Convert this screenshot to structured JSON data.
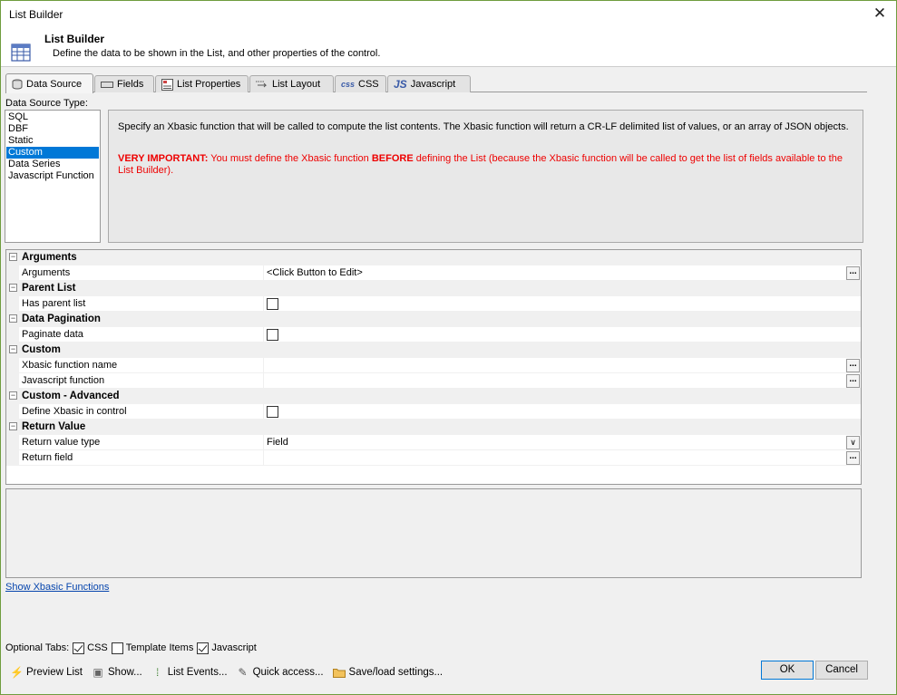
{
  "window": {
    "title": "List Builder",
    "close_glyph": "✕"
  },
  "header": {
    "icon": "table-icon",
    "title": "List Builder",
    "description": "Define the data to be shown in the List, and other properties of the control."
  },
  "tabs": [
    {
      "label": "Data Source",
      "icon": "database-icon",
      "active": true
    },
    {
      "label": "Fields",
      "icon": "field-icon"
    },
    {
      "label": "List Properties",
      "icon": "properties-icon"
    },
    {
      "label": "List Layout",
      "icon": "layout-icon"
    },
    {
      "label": "CSS",
      "icon": "css-icon",
      "icon_text": "css"
    },
    {
      "label": "Javascript",
      "icon": "js-icon",
      "icon_text": "JS"
    }
  ],
  "data_source": {
    "label": "Data Source Type:",
    "items": [
      "SQL",
      "DBF",
      "Static",
      "Custom",
      "Data Series",
      "Javascript Function"
    ],
    "selected": "Custom"
  },
  "info": {
    "text": "Specify an Xbasic function that will be called to compute the list contents. The Xbasic function will return a CR-LF delimited list of values, or an array of JSON objects.",
    "warn_prefix": "VERY IMPORTANT:",
    "warn_part1": " You must define the Xbasic function ",
    "warn_bold": "BEFORE",
    "warn_part2": " defining the List (because the Xbasic function will be called to get the list of fields available to the List Builder)."
  },
  "grid": {
    "sections": [
      {
        "title": "Arguments",
        "rows": [
          {
            "name": "Arguments",
            "value": "<Click Button to Edit>",
            "control": "button"
          }
        ]
      },
      {
        "title": "Parent List",
        "rows": [
          {
            "name": "Has parent list",
            "control": "checkbox",
            "checked": false
          }
        ]
      },
      {
        "title": "Data Pagination",
        "rows": [
          {
            "name": "Paginate data",
            "control": "checkbox",
            "checked": false
          }
        ]
      },
      {
        "title": "Custom",
        "rows": [
          {
            "name": "Xbasic function name",
            "value": "",
            "control": "button"
          },
          {
            "name": "Javascript function",
            "value": "",
            "control": "button"
          }
        ]
      },
      {
        "title": "Custom - Advanced",
        "rows": [
          {
            "name": "Define Xbasic in control",
            "control": "checkbox",
            "checked": false
          }
        ]
      },
      {
        "title": "Return Value",
        "rows": [
          {
            "name": "Return value type",
            "value": "Field",
            "control": "dropdown"
          },
          {
            "name": "Return field",
            "value": "",
            "control": "button"
          }
        ]
      }
    ],
    "expand_glyph": "−",
    "button_glyph": "...",
    "dropdown_glyph": "∨"
  },
  "link": {
    "label": "Show Xbasic Functions"
  },
  "optional_tabs": {
    "label": "Optional Tabs:",
    "items": [
      {
        "label": "CSS",
        "checked": true
      },
      {
        "label": "Template Items",
        "checked": false
      },
      {
        "label": "Javascript",
        "checked": true
      }
    ]
  },
  "toolbar": [
    {
      "label": "Preview List",
      "icon": "lightning-icon",
      "glyph": "⚡",
      "color": "#e0a800"
    },
    {
      "label": "Show...",
      "icon": "show-icon",
      "glyph": "▣",
      "color": "#666666"
    },
    {
      "label": "List Events...",
      "icon": "events-icon",
      "glyph": "⁞",
      "color": "#3a7d2c"
    },
    {
      "label": "Quick access...",
      "icon": "wand-icon",
      "glyph": "✎",
      "color": "#555555"
    },
    {
      "label": "Save/load settings...",
      "icon": "folder-icon",
      "glyph": "▬",
      "color": "#e8b84a"
    }
  ],
  "buttons": {
    "ok": "OK",
    "cancel": "Cancel"
  }
}
